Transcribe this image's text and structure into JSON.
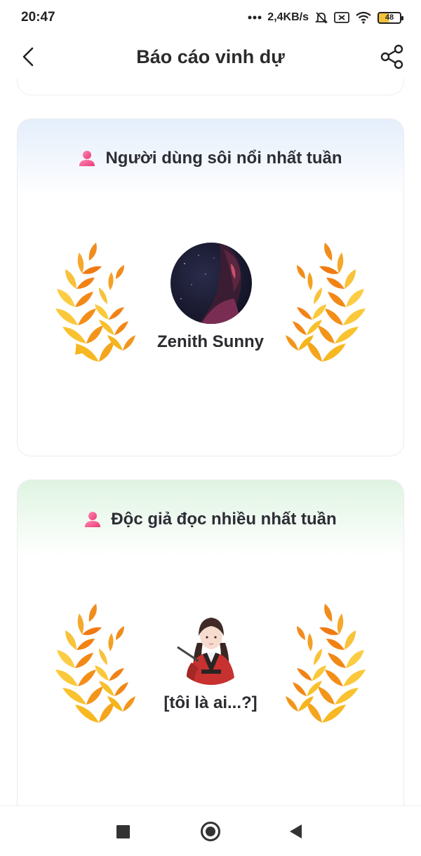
{
  "status_bar": {
    "time": "20:47",
    "network_speed": "2,4KB/s",
    "battery_level": "48",
    "icons": [
      "dots-icon",
      "mute-bell-icon",
      "sim-x-icon",
      "wifi-icon",
      "battery-icon"
    ]
  },
  "header": {
    "title": "Báo cáo vinh dự",
    "back_icon": "chevron-left-icon",
    "share_icon": "share-icon"
  },
  "cards": [
    {
      "heading": "Người dùng sôi nổi nhất tuần",
      "icon": "person-icon",
      "user_name": "Zenith Sunny",
      "accent_color": "#e4eefb"
    },
    {
      "heading": "Độc giả đọc nhiều nhất tuần",
      "icon": "person-icon",
      "user_name": "[tôi là ai...?]",
      "accent_color": "#dff4e2"
    }
  ],
  "colors": {
    "laurel_gold": "#f5b51e",
    "laurel_orange": "#f07a12",
    "person_icon_pink": "#f0508a"
  },
  "nav_bar": {
    "icons": [
      "recents-square-icon",
      "home-circle-icon",
      "back-triangle-icon"
    ]
  }
}
